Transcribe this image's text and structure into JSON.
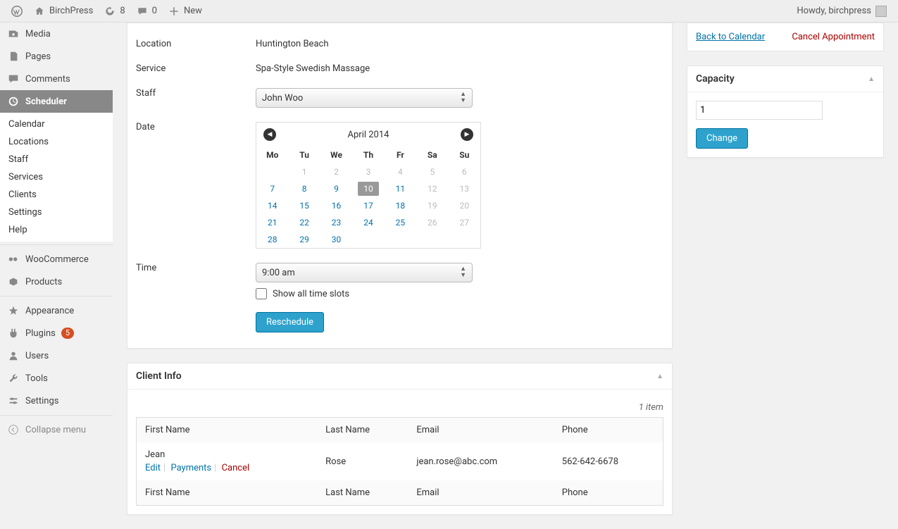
{
  "toolbar": {
    "site": "BirchPress",
    "updates": "8",
    "comments": "0",
    "new": "New",
    "howdy": "Howdy, birchpress"
  },
  "menu": {
    "media": "Media",
    "pages": "Pages",
    "comments": "Comments",
    "scheduler": "Scheduler",
    "sub": {
      "calendar": "Calendar",
      "locations": "Locations",
      "staff": "Staff",
      "services": "Services",
      "clients": "Clients",
      "settings": "Settings",
      "help": "Help"
    },
    "woo": "WooCommerce",
    "products": "Products",
    "appearance": "Appearance",
    "plugins": "Plugins",
    "plugins_badge": "5",
    "users": "Users",
    "tools": "Tools",
    "settings": "Settings",
    "collapse": "Collapse menu"
  },
  "form": {
    "location_lbl": "Location",
    "location_val": "Huntington Beach",
    "service_lbl": "Service",
    "service_val": "Spa-Style Swedish Massage",
    "staff_lbl": "Staff",
    "staff_val": "John Woo",
    "date_lbl": "Date",
    "calendar": {
      "title": "April 2014",
      "days": [
        "Mo",
        "Tu",
        "We",
        "Th",
        "Fr",
        "Sa",
        "Su"
      ],
      "weeks": [
        [
          {
            "n": "",
            "dis": true
          },
          {
            "n": "1",
            "dis": true
          },
          {
            "n": "2",
            "dis": true
          },
          {
            "n": "3",
            "dis": true
          },
          {
            "n": "4",
            "dis": true
          },
          {
            "n": "5",
            "dis": true
          },
          {
            "n": "6",
            "dis": true
          }
        ],
        [
          {
            "n": "7"
          },
          {
            "n": "8"
          },
          {
            "n": "9"
          },
          {
            "n": "10",
            "sel": true
          },
          {
            "n": "11"
          },
          {
            "n": "12",
            "dis": true
          },
          {
            "n": "13",
            "dis": true
          }
        ],
        [
          {
            "n": "14"
          },
          {
            "n": "15"
          },
          {
            "n": "16"
          },
          {
            "n": "17"
          },
          {
            "n": "18"
          },
          {
            "n": "19",
            "dis": true
          },
          {
            "n": "20",
            "dis": true
          }
        ],
        [
          {
            "n": "21"
          },
          {
            "n": "22"
          },
          {
            "n": "23"
          },
          {
            "n": "24"
          },
          {
            "n": "25"
          },
          {
            "n": "26",
            "dis": true
          },
          {
            "n": "27",
            "dis": true
          }
        ],
        [
          {
            "n": "28"
          },
          {
            "n": "29"
          },
          {
            "n": "30"
          },
          {
            "n": ""
          },
          {
            "n": ""
          },
          {
            "n": ""
          },
          {
            "n": ""
          }
        ]
      ]
    },
    "time_lbl": "Time",
    "time_val": "9:00 am",
    "showall": "Show all time slots",
    "reschedule": "Reschedule"
  },
  "client": {
    "title": "Client Info",
    "count": "1 item",
    "headers": {
      "first": "First Name",
      "last": "Last Name",
      "email": "Email",
      "phone": "Phone"
    },
    "row": {
      "first": "Jean",
      "last": "Rose",
      "email": "jean.rose@abc.com",
      "phone": "562-642-6678"
    },
    "actions": {
      "edit": "Edit",
      "payments": "Payments",
      "cancel": "Cancel"
    }
  },
  "side": {
    "back": "Back to Calendar",
    "cancel": "Cancel Appointment",
    "capacity_title": "Capacity",
    "capacity_val": "1",
    "change": "Change"
  }
}
